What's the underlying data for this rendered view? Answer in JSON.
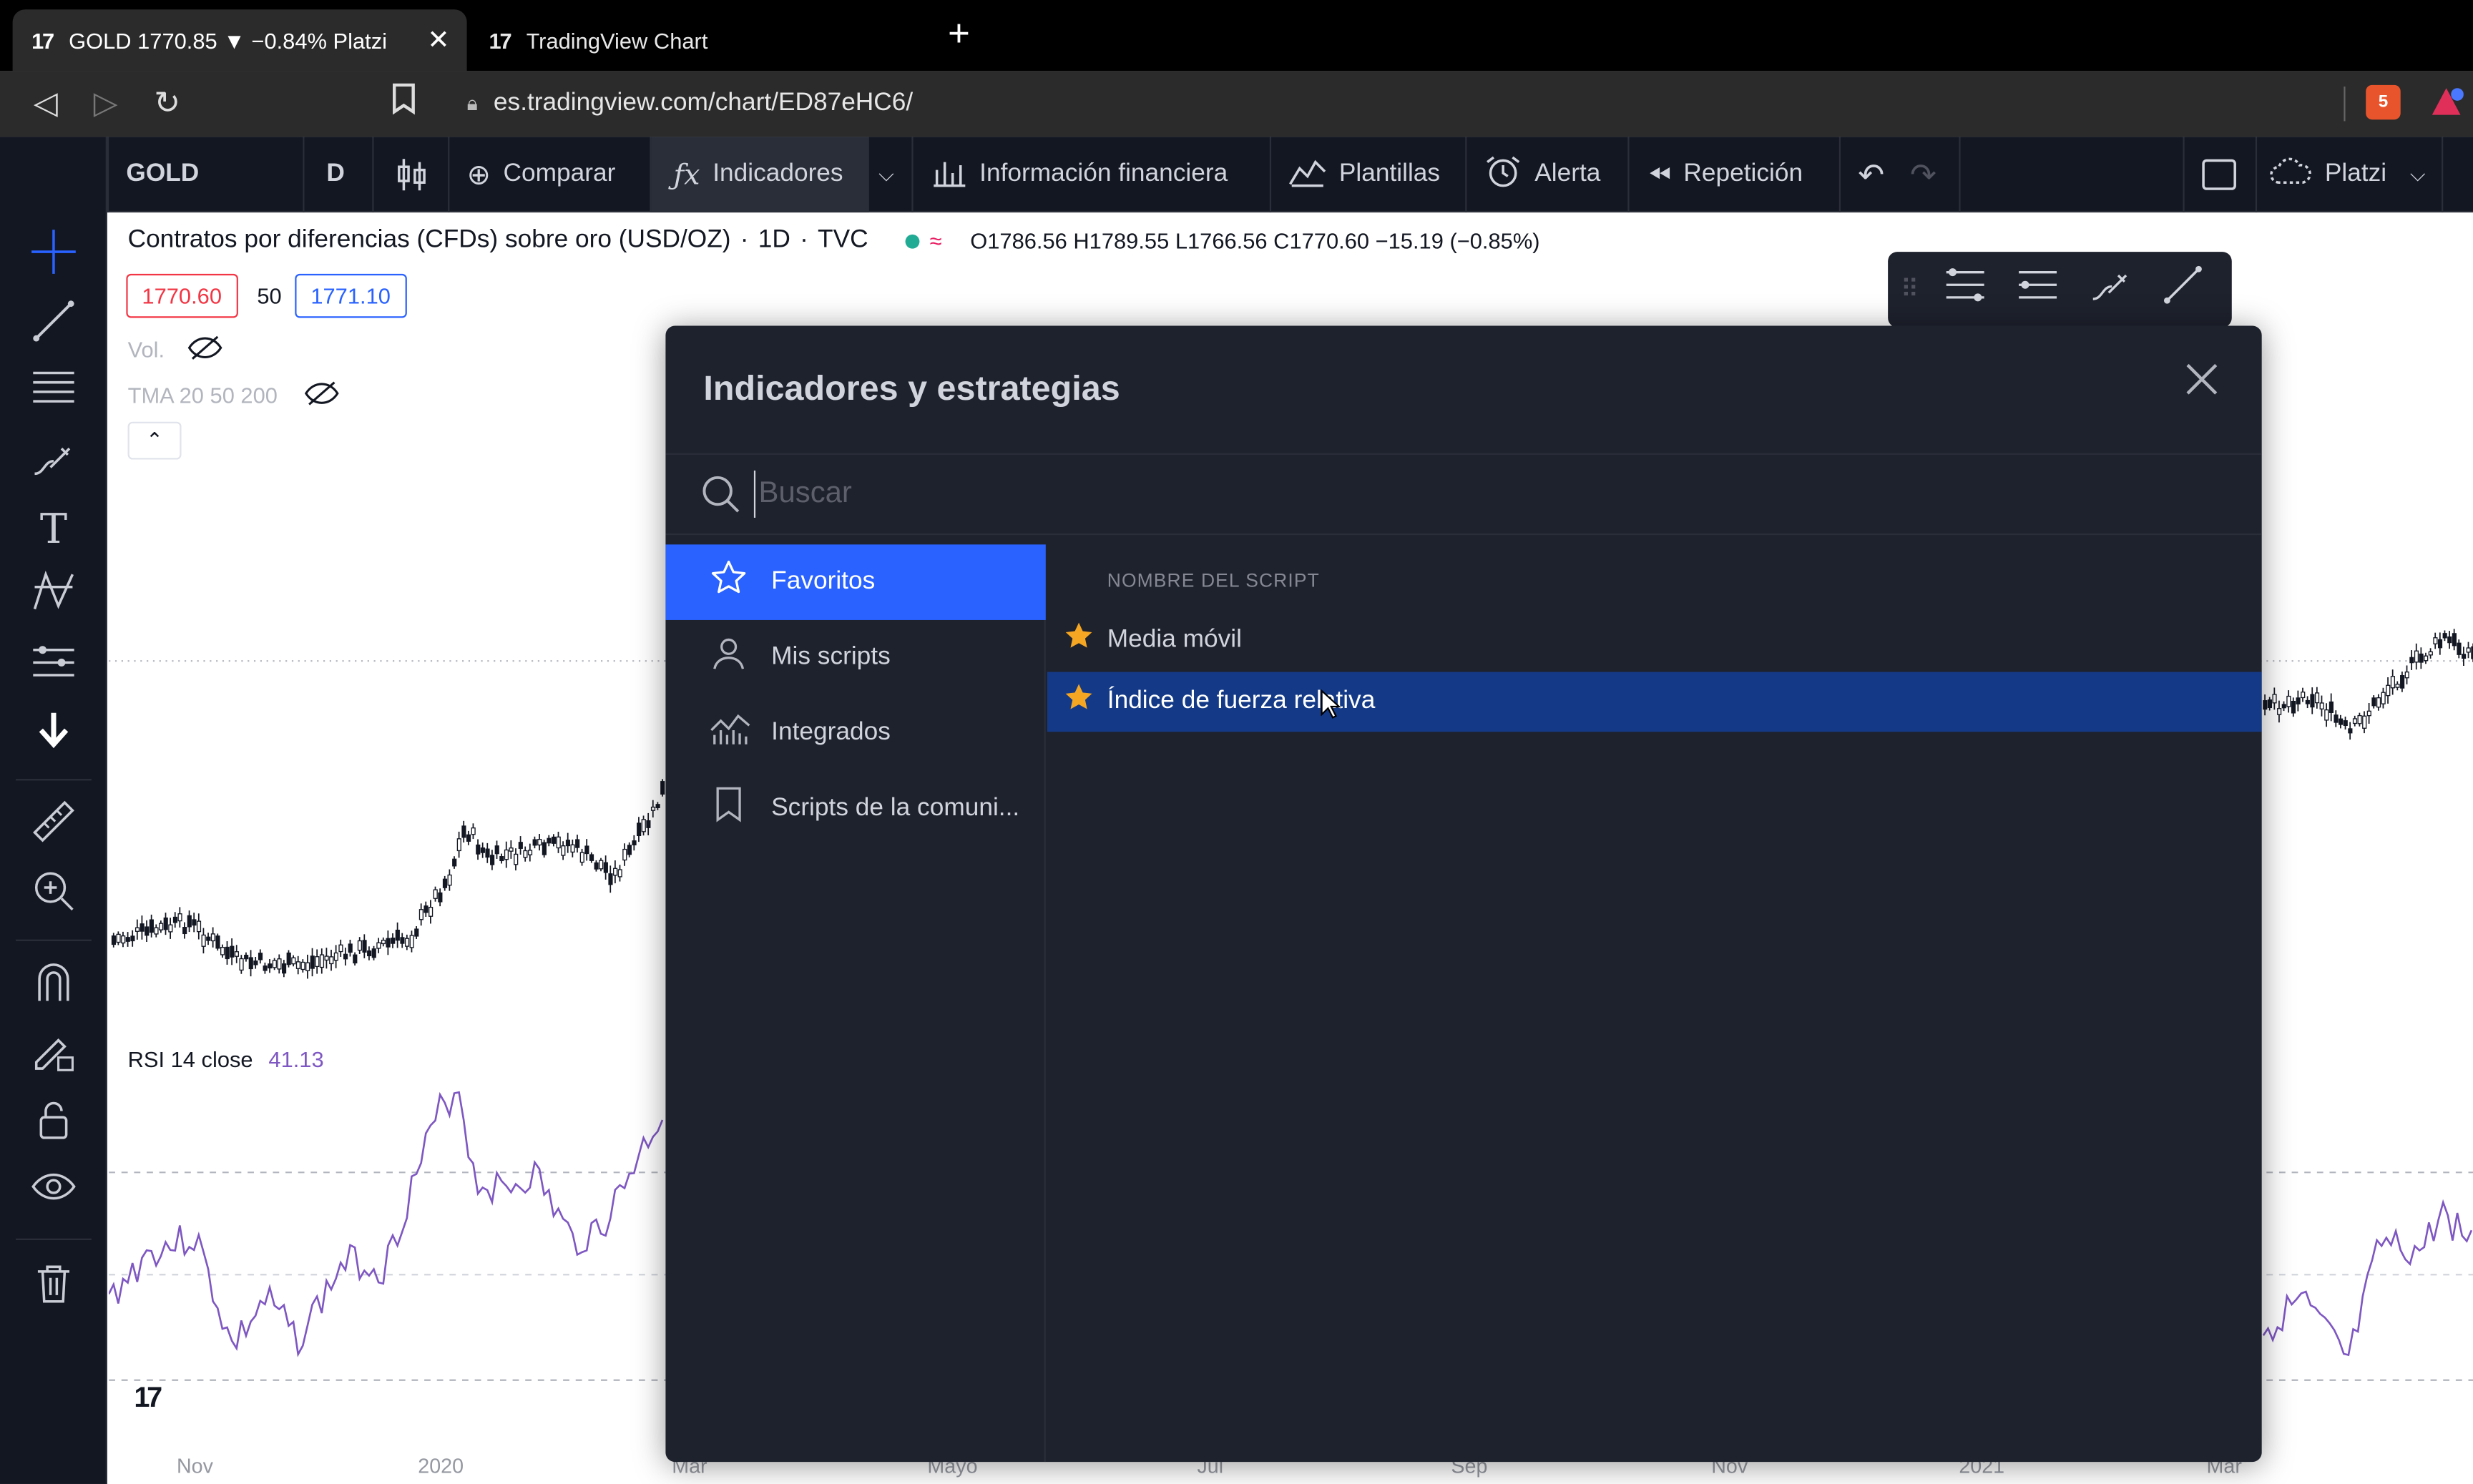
{
  "browser": {
    "tabs": [
      {
        "logo": "17",
        "title": "GOLD 1770.85 ▼ −0.84% Platzi",
        "close": "✕"
      },
      {
        "logo": "17",
        "title": "TradingView Chart"
      }
    ],
    "new_tab": "+",
    "url": "es.tradingview.com/chart/ED87eHC6/",
    "ext_badge": "5"
  },
  "toolbar": {
    "symbol": "GOLD",
    "interval": "D",
    "compare": "Comparar",
    "indicators": "Indicadores",
    "financials": "Información financiera",
    "templates": "Plantillas",
    "alert": "Alerta",
    "replay": "Repetición",
    "layout_name": "Platzi"
  },
  "chart": {
    "title": "Contratos por diferencias (CFDs) sobre oro (USD/OZ)",
    "separator": "·",
    "interval": "1D",
    "exchange": "TVC",
    "ohlc": "O1786.56  H1789.55  L1766.56  C1770.60  −15.19 (−0.85%)",
    "bid": "1770.60",
    "spread": "50",
    "ask": "1771.10",
    "vol_label": "Vol.",
    "tma_label": "TMA 20 50 200",
    "rsi_label": "RSI 14 close",
    "rsi_value": "41.13",
    "watermark": "17",
    "x_ticks": [
      "Nov",
      "2020",
      "Mar",
      "Mayo",
      "Jul",
      "Sep",
      "Nov",
      "2021",
      "Mar"
    ],
    "colors": {
      "bid": "#f23645",
      "ask": "#2962ff",
      "rsi_line": "#7e57c2",
      "candles": "#131722"
    }
  },
  "modal": {
    "title": "Indicadores y estrategias",
    "search_placeholder": "Buscar",
    "categories": [
      {
        "label": "Favoritos",
        "icon": "star-icon",
        "active": true
      },
      {
        "label": "Mis scripts",
        "icon": "user-icon"
      },
      {
        "label": "Integrados",
        "icon": "chart-icon"
      },
      {
        "label": "Scripts de la comuni...",
        "icon": "bookmark-icon"
      }
    ],
    "list_header": "NOMBRE DEL SCRIPT",
    "scripts": [
      {
        "label": "Media móvil",
        "favorite": true
      },
      {
        "label": "Índice de fuerza relativa",
        "favorite": true,
        "selected": true
      }
    ]
  }
}
